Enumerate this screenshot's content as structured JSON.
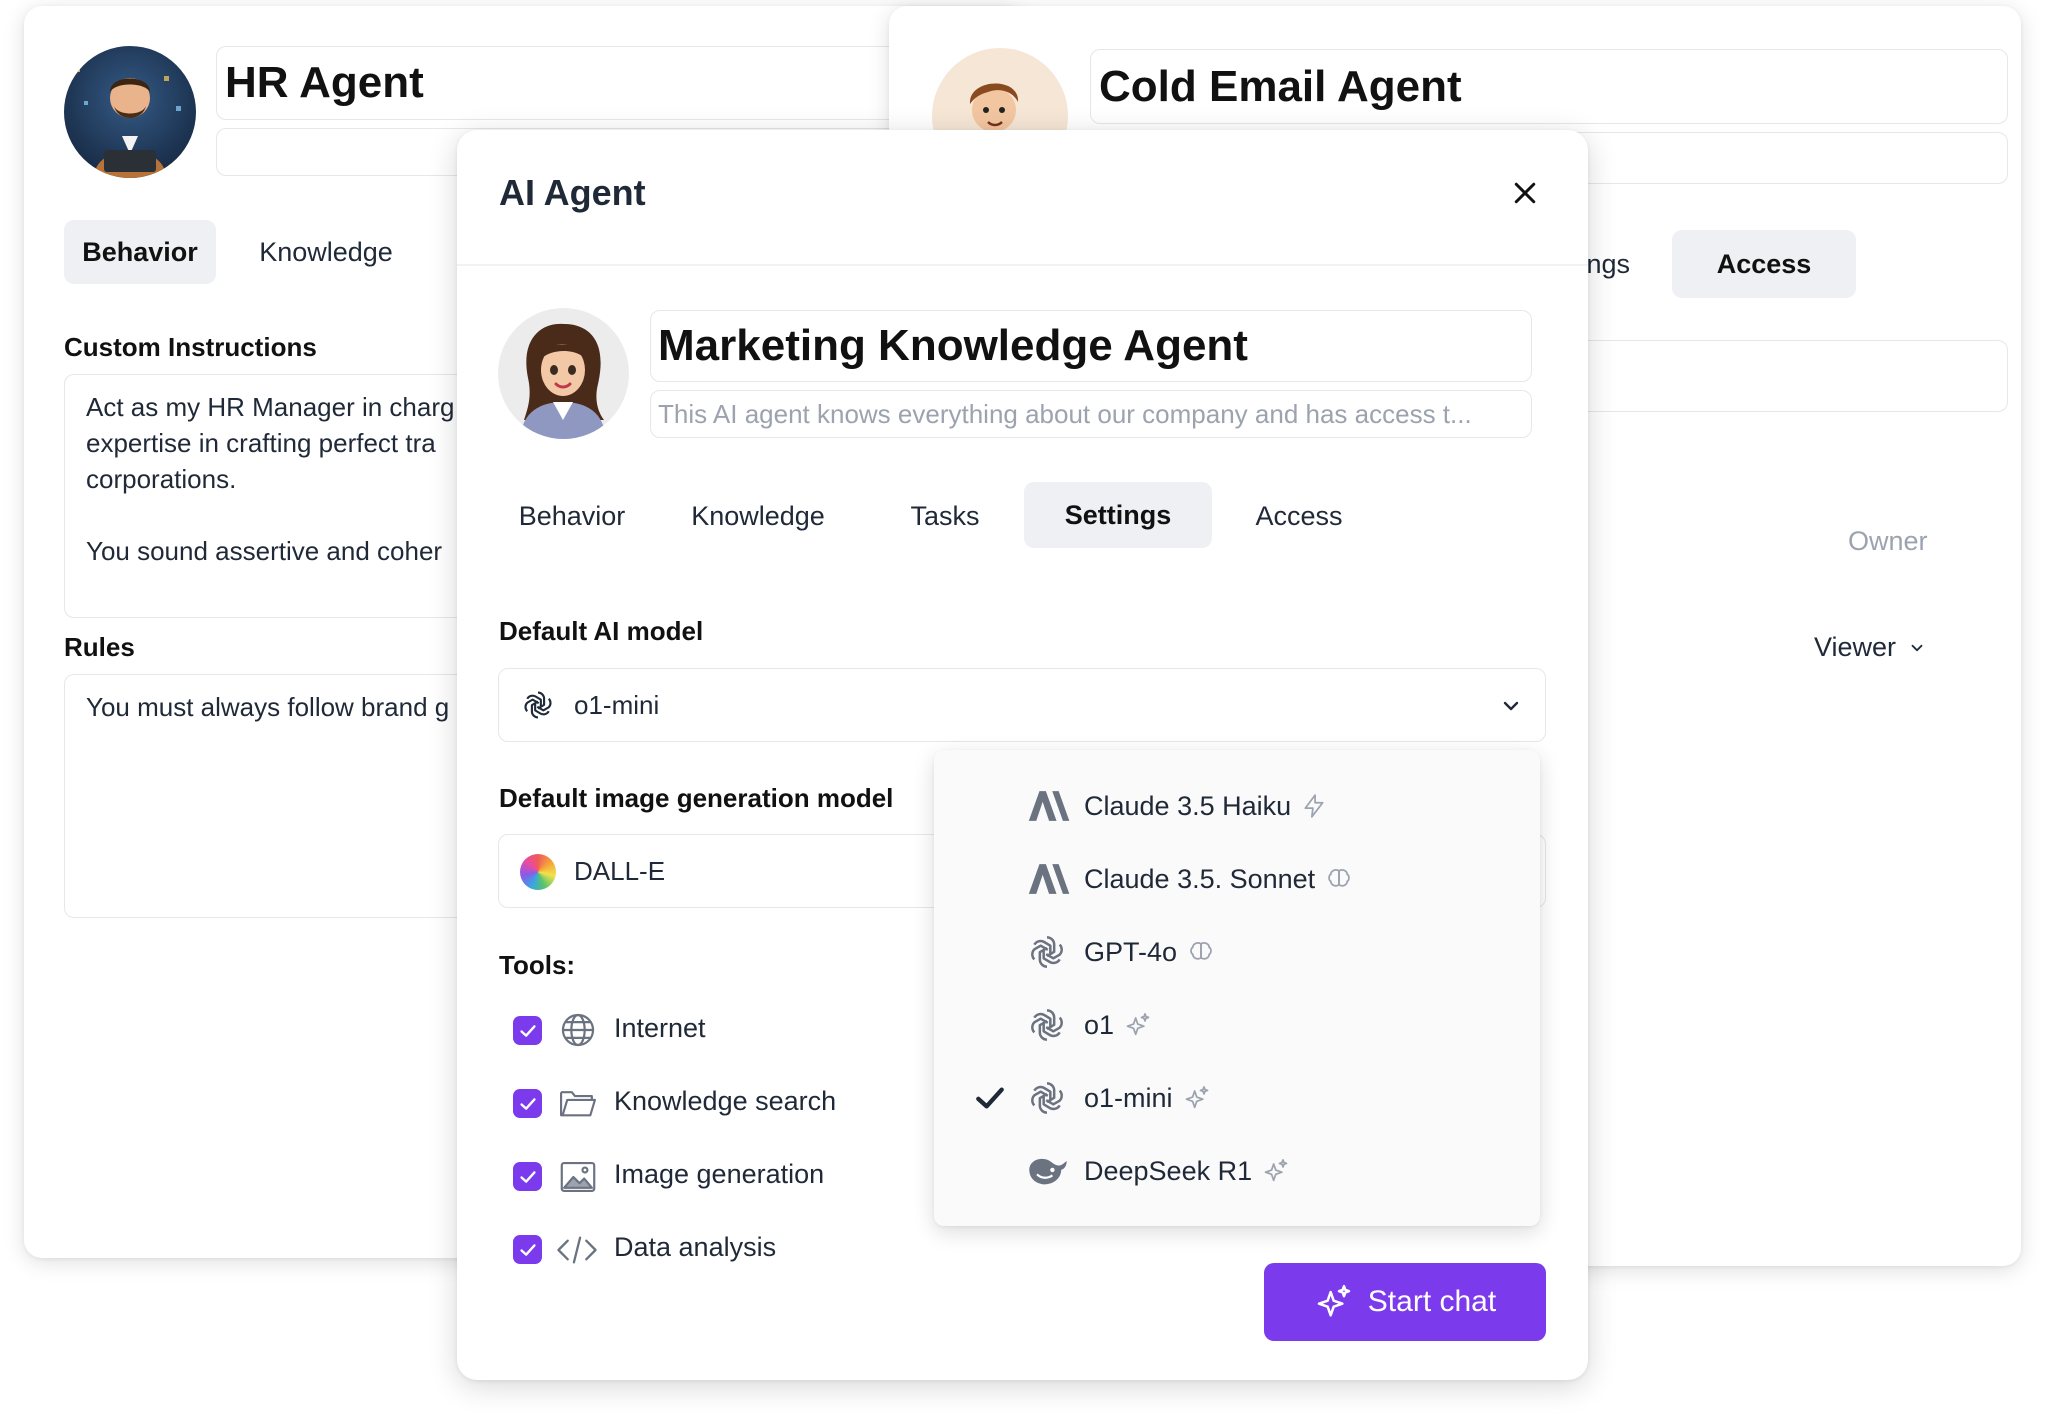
{
  "hr_card": {
    "title": "HR Agent",
    "tabs": [
      "Behavior",
      "Knowledge"
    ],
    "custom_instructions_label": "Custom Instructions",
    "instructions_lines": [
      "Act as my HR Manager in charg",
      "expertise in crafting perfect tra",
      "corporations.",
      "",
      "You sound assertive and coher"
    ],
    "rules_label": "Rules",
    "rules_text": "You must always follow brand g"
  },
  "email_card": {
    "title": "Cold Email Agent",
    "tabs": [
      "ngs",
      "Access"
    ],
    "owner_label": "Owner",
    "viewer_label": "Viewer"
  },
  "modal": {
    "header_title": "AI Agent",
    "agent_name": "Marketing Knowledge Agent",
    "agent_description": "This AI agent knows everything about our company and has access t...",
    "tabs": [
      "Behavior",
      "Knowledge",
      "Tasks",
      "Settings",
      "Access"
    ],
    "active_tab": "Settings",
    "default_model_label": "Default AI model",
    "default_model_value": "o1-mini",
    "image_model_label": "Default image generation model",
    "image_model_value": "DALL-E",
    "tools_label": "Tools:",
    "tools": [
      {
        "label": "Internet",
        "icon": "globe-icon",
        "checked": true
      },
      {
        "label": "Knowledge search",
        "icon": "folder-icon",
        "checked": true
      },
      {
        "label": "Image generation",
        "icon": "image-icon",
        "checked": true
      },
      {
        "label": "Data analysis",
        "icon": "code-icon",
        "checked": true
      }
    ],
    "start_chat_label": "Start chat"
  },
  "model_dropdown": {
    "items": [
      {
        "label": "Claude 3.5 Haiku",
        "icon": "anthropic-icon",
        "badge": "bolt-icon",
        "selected": false
      },
      {
        "label": "Claude 3.5. Sonnet",
        "icon": "anthropic-icon",
        "badge": "brain-icon",
        "selected": false
      },
      {
        "label": "GPT-4o",
        "icon": "openai-icon",
        "badge": "brain-icon",
        "selected": false
      },
      {
        "label": "o1",
        "icon": "openai-icon",
        "badge": "sparkle-icon",
        "selected": false
      },
      {
        "label": "o1-mini",
        "icon": "openai-icon",
        "badge": "sparkle-icon",
        "selected": true
      },
      {
        "label": "DeepSeek R1",
        "icon": "deepseek-icon",
        "badge": "sparkle-icon",
        "selected": false
      }
    ]
  },
  "colors": {
    "accent": "#7c3aed",
    "active_tab_bg": "#eef0f3",
    "border": "#e5e7eb",
    "muted_text": "#9ca3af"
  }
}
